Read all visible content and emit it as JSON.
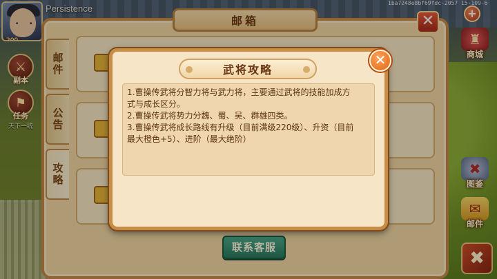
{
  "hud": {
    "player_name": "Persistence",
    "player_level": "200",
    "left_buttons": [
      {
        "label": "副本",
        "sub": ""
      },
      {
        "label": "任务",
        "sub": "天下一统"
      }
    ],
    "right_buttons": [
      {
        "label": "商城",
        "icon": "shop-icon"
      },
      {
        "label": "图鉴",
        "icon": "codex-icon"
      },
      {
        "label": "邮件",
        "icon": "mail-icon"
      }
    ],
    "plus_label": "+",
    "corner_icon": "swords-icon",
    "debug_id": "1ba7248e8bf69fdc-2057 15-109-6"
  },
  "mailbox": {
    "title": "邮箱",
    "tabs": [
      "邮件",
      "公告",
      "攻略"
    ],
    "active_tab": "攻略",
    "contact_button": "联系客服"
  },
  "popup": {
    "title": "武将攻略",
    "close_icon": "close-icon",
    "lines": [
      "1.曹操传武将分智力将与武力将，主要通过武将的技能加成方",
      "式与成长区分。",
      "2.曹操传武将势力分魏、蜀、吴、群雄四类。",
      "3.曹操传武将成长路线有升级（目前满级220级）、升资（目前",
      "最大橙色+5）、进阶（最大绝阶）"
    ]
  },
  "colors": {
    "popup_bg": "#f6e6c7",
    "popup_border": "#c88c44",
    "text_brown": "#5b3517",
    "close_orange": "#e06414",
    "contact_green": "#2c7a5f"
  }
}
